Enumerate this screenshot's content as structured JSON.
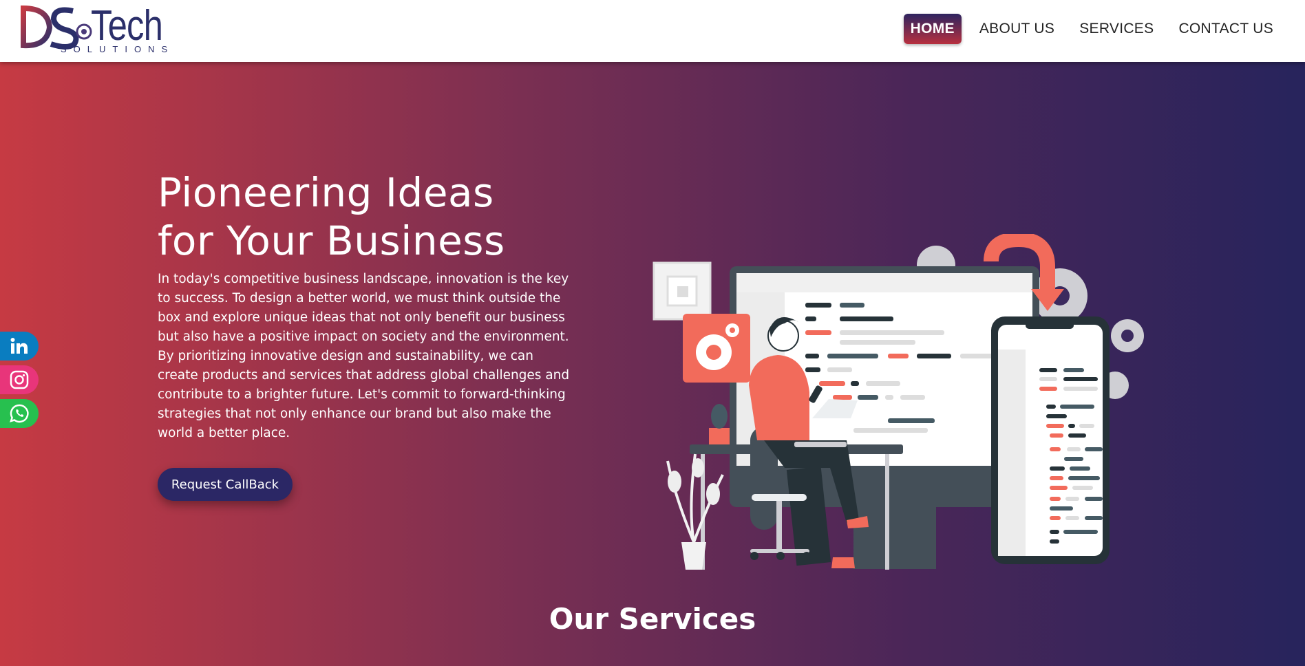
{
  "brand": {
    "logo_text": "DS Tech",
    "logo_sub": "SOLUTIONS",
    "colors": {
      "navy": "#2b2f6a",
      "red": "#c63a43"
    }
  },
  "nav": {
    "items": [
      {
        "label": "HOME",
        "active": true
      },
      {
        "label": "ABOUT US",
        "active": false
      },
      {
        "label": "SERVICES",
        "active": false
      },
      {
        "label": "CONTACT US",
        "active": false
      }
    ]
  },
  "hero": {
    "title_line1": "Pioneering Ideas",
    "title_line2": "for Your Business",
    "body": "In today's competitive business landscape, innovation is the key to success. To design a better world, we must think outside the box and explore unique ideas that not only benefit our business but also have a positive impact on society and the environment. By prioritizing innovative design and sustainability, we can create products and services that address global challenges and contribute to a brighter future. Let's commit to forward-thinking strategies that not only enhance our brand but also make the world a better place.",
    "cta_label": "Request CallBack",
    "gradient": [
      "#c63a43",
      "#27245c"
    ]
  },
  "services": {
    "title": "Our Services"
  },
  "social": [
    {
      "name": "linkedin-icon",
      "color": "#0a7dc0"
    },
    {
      "name": "instagram-icon",
      "color": "#e8357a"
    },
    {
      "name": "whatsapp-icon",
      "color": "#27c04f"
    }
  ]
}
